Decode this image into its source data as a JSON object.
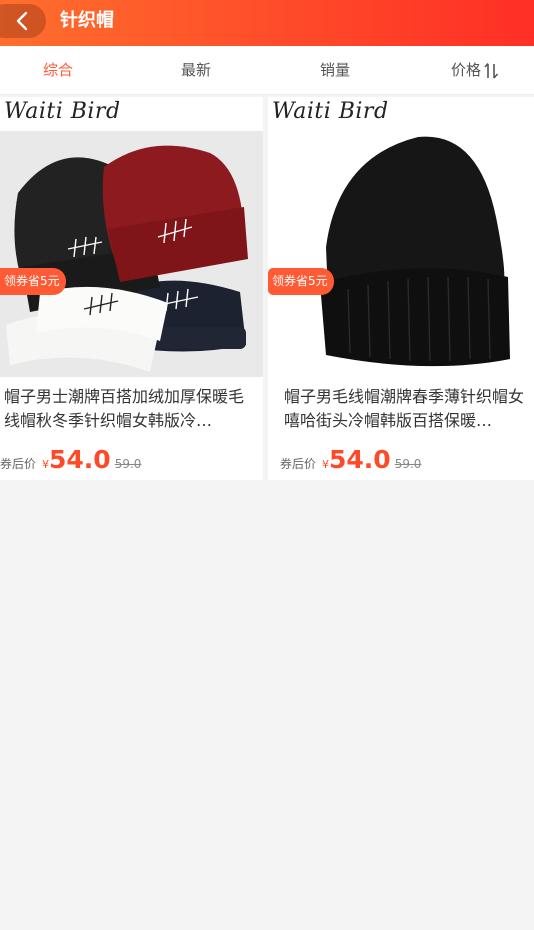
{
  "header": {
    "title": "针织帽",
    "back_icon": "chevron-left-icon",
    "gradient_colors": [
      "#ff6f2c",
      "#ff2f25"
    ]
  },
  "tabs": [
    {
      "label": "综合",
      "active": true
    },
    {
      "label": "最新",
      "active": false
    },
    {
      "label": "销量",
      "active": false
    },
    {
      "label": "价格",
      "active": false,
      "icon": "sort-arrows-icon"
    }
  ],
  "accent_color": "#ff5a36",
  "products": [
    {
      "brand_logo": "WaitBird",
      "coupon": "领券省5元",
      "name": "帽子男士潮牌百搭加绒加厚保暖毛线帽秋冬季针织帽女韩版冷…",
      "price_label": "券后价",
      "currency": "¥",
      "price": "54.0",
      "original_price": "59.0"
    },
    {
      "brand_logo": "WaitBird",
      "coupon": "领券省5元",
      "name": "帽子男毛线帽潮牌春季薄针织帽女嘻哈街头冷帽韩版百搭保暖…",
      "price_label": "券后价",
      "currency": "¥",
      "price": "54.0",
      "original_price": "59.0"
    }
  ]
}
